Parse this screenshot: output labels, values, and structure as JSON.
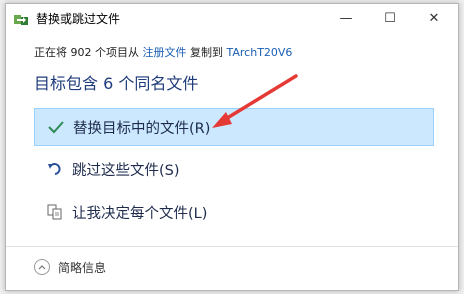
{
  "window": {
    "title": "替换或跳过文件",
    "minimize_glyph": "—",
    "maximize_glyph": "☐",
    "close_glyph": "✕"
  },
  "info": {
    "prefix": "正在将 902 个项目从 ",
    "source": "注册文件",
    "middle": " 复制到 ",
    "destination": "TArchT20V6"
  },
  "heading": "目标包含 6 个同名文件",
  "options": [
    {
      "label": "替换目标中的文件(R)",
      "icon": "checkmark-icon",
      "selected": true
    },
    {
      "label": "跳过这些文件(S)",
      "icon": "skip-arrow-icon",
      "selected": false
    },
    {
      "label": "让我决定每个文件(L)",
      "icon": "compare-files-icon",
      "selected": false
    }
  ],
  "details": {
    "label": "简略信息",
    "icon": "collapse-up-icon"
  },
  "colors": {
    "selected_bg": "#cce8ff",
    "selected_border": "#99d1ff",
    "heading": "#1e3b7a",
    "link": "#1a5fb4",
    "arrow": "#e53935",
    "check": "#2e8b57"
  }
}
